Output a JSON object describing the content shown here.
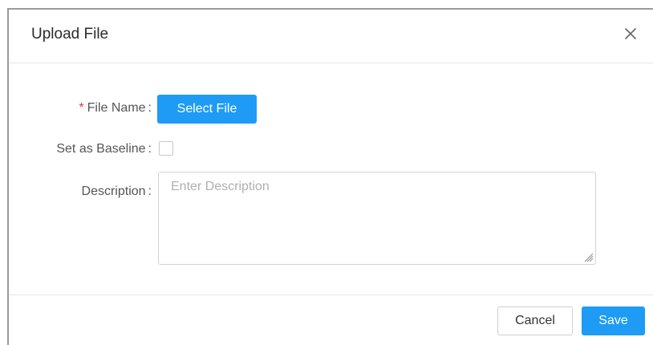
{
  "dialog": {
    "title": "Upload File",
    "close_icon": "close-icon"
  },
  "form": {
    "file_name": {
      "required_mark": "*",
      "label": "File Name",
      "colon": ":",
      "button_label": "Select File"
    },
    "baseline": {
      "label": "Set as Baseline",
      "colon": ":",
      "checked": false
    },
    "description": {
      "label": "Description",
      "colon": ":",
      "placeholder": "Enter Description",
      "value": ""
    }
  },
  "footer": {
    "cancel_label": "Cancel",
    "save_label": "Save"
  },
  "colors": {
    "primary": "#1e9bf5",
    "required": "#e0393e"
  }
}
